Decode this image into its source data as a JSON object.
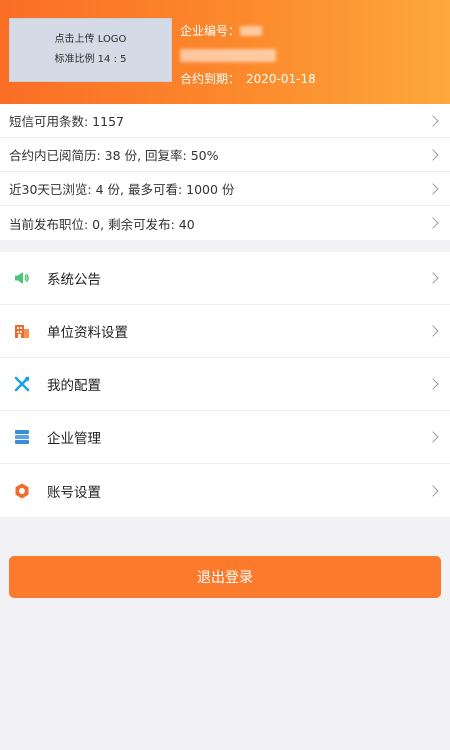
{
  "header": {
    "logo_line1": "点击上传 LOGO",
    "logo_line2": "标准比例 14 : 5",
    "company_id_label": "企业编号：",
    "contract_label": "合约到期：",
    "contract_date": "2020-01-18"
  },
  "stats": [
    {
      "label": "短信可用条数: 1157"
    },
    {
      "label": "合约内已阅简历: 38 份, 回复率: 50%"
    },
    {
      "label": "近30天已浏览: 4 份, 最多可看: 1000 份"
    },
    {
      "label": "当前发布职位: 0, 剩余可发布: 40"
    }
  ],
  "menu": [
    {
      "label": "系统公告",
      "icon": "speaker-icon",
      "color": "#4cc47a"
    },
    {
      "label": "单位资料设置",
      "icon": "building-icon",
      "color": "#f26b2d"
    },
    {
      "label": "我的配置",
      "icon": "tools-icon",
      "color": "#1aa1e6"
    },
    {
      "label": "企业管理",
      "icon": "server-icon",
      "color": "#3b8ddb"
    },
    {
      "label": "账号设置",
      "icon": "gear-icon",
      "color": "#f26b2d"
    }
  ],
  "logout_label": "退出登录",
  "colors": {
    "accent": "#fb7a2c",
    "header_start": "#fb6e25",
    "header_end": "#fda83a"
  }
}
